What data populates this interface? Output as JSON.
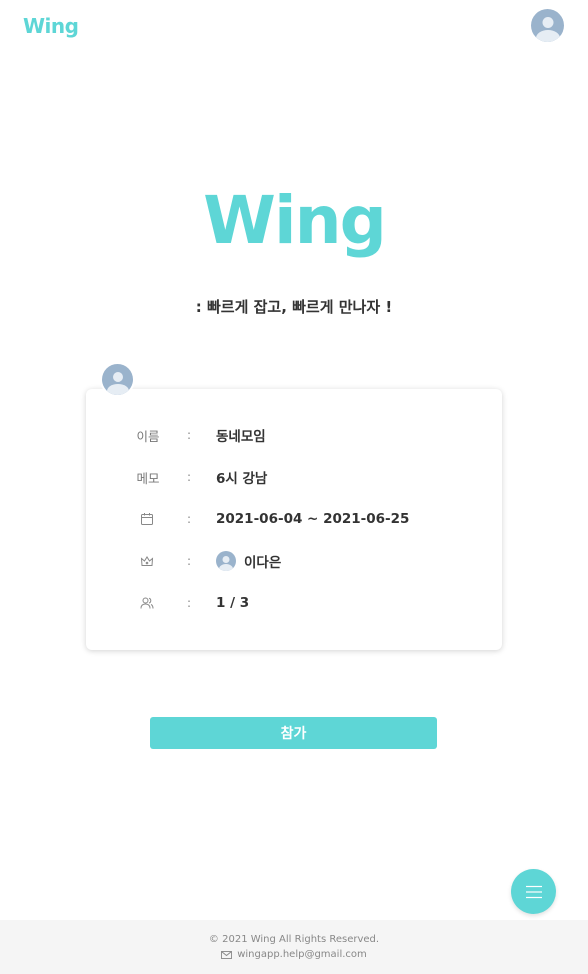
{
  "header": {
    "logo": "Wing",
    "profile_icon": "user-avatar-icon"
  },
  "hero": {
    "logo": "Wing",
    "tagline": ": 빠르게 잡고, 빠르게 만나자 !"
  },
  "card": {
    "host_avatar_icon": "user-avatar-icon",
    "rows": [
      {
        "label": "이름",
        "value": "동네모임"
      },
      {
        "label": "메모",
        "value": "6시 강남"
      },
      {
        "icon": "calendar-icon",
        "value": "2021-06-04 ~ 2021-06-25"
      },
      {
        "icon": "crown-icon",
        "value": "이다은"
      },
      {
        "icon": "users-icon",
        "value": "1 / 3"
      }
    ],
    "separator": ":"
  },
  "join_button": {
    "label": "참가"
  },
  "fab": {
    "icon": "menu-icon"
  },
  "footer": {
    "copyright": "© 2021 Wing All Rights Reserved.",
    "email_icon": "mail-icon",
    "email": "wingapp.help@gmail.com"
  },
  "colors": {
    "accent": "#5ed6d6",
    "avatar": "#9ab3cc",
    "footer_bg": "#f5f5f5"
  }
}
